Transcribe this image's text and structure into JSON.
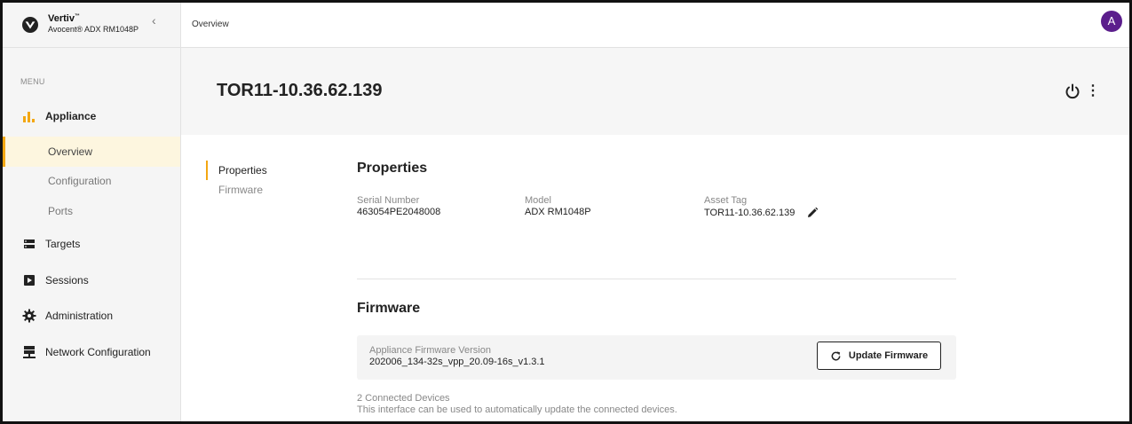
{
  "brand": {
    "name": "Vertiv",
    "tm": "™",
    "product": "Avocent® ADX RM1048P",
    "collapse_glyph": "‹"
  },
  "sidebar": {
    "menu_label": "MENU",
    "items": [
      {
        "label": "Appliance",
        "icon": "bar-chart-icon"
      },
      {
        "label": "Overview"
      },
      {
        "label": "Configuration"
      },
      {
        "label": "Ports"
      },
      {
        "label": "Targets",
        "icon": "server-icon"
      },
      {
        "label": "Sessions",
        "icon": "play-box-icon"
      },
      {
        "label": "Administration",
        "icon": "gear-icon"
      },
      {
        "label": "Network Configuration",
        "icon": "network-icon"
      }
    ]
  },
  "topbar": {
    "breadcrumb": "Overview",
    "avatar_initial": "A"
  },
  "header": {
    "title": "TOR11-10.36.62.139",
    "kebab": "⋮"
  },
  "section_nav": [
    "Properties",
    "Firmware"
  ],
  "properties": {
    "title": "Properties",
    "fields": [
      {
        "label": "Serial Number",
        "value": "463054PE2048008"
      },
      {
        "label": "Model",
        "value": "ADX RM1048P"
      },
      {
        "label": "Asset Tag",
        "value": "TOR11-10.36.62.139"
      }
    ]
  },
  "firmware": {
    "title": "Firmware",
    "version_label": "Appliance Firmware Version",
    "version_value": "202006_134-32s_vpp_20.09-16s_v1.3.1",
    "update_button": "Update Firmware",
    "connected": "2 Connected Devices",
    "connected_desc": "This interface can be used to automatically update the connected devices."
  },
  "colors": {
    "accent": "#f3a712",
    "avatar": "#5b1e8c",
    "selected_bg": "#fdf6df"
  }
}
